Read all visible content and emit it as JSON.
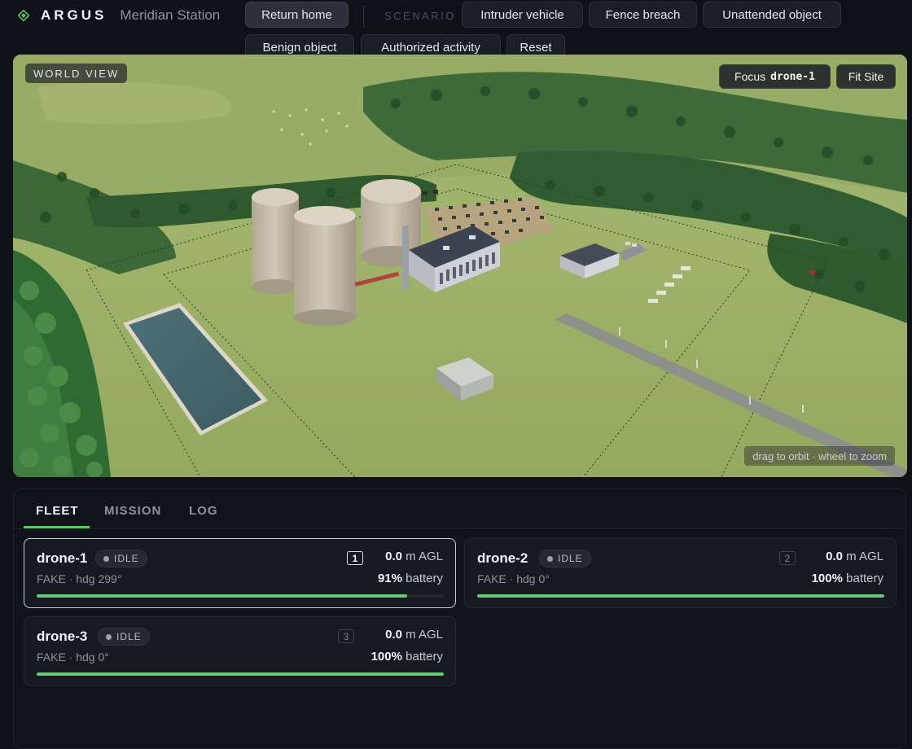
{
  "header": {
    "brand": "ARGUS",
    "station": "Meridian Station",
    "return_home": "Return home",
    "scenario_label": "SCENARIO",
    "scenarios": [
      "Intruder vehicle",
      "Fence breach",
      "Unattended object",
      "Benign object",
      "Authorized activity",
      "Reset"
    ]
  },
  "world": {
    "title": "WORLD VIEW",
    "focus_label": "Focus",
    "focus_target": "drone-1",
    "fit_site": "Fit Site",
    "hint": "drag to orbit · wheel to zoom"
  },
  "tabs": [
    "FLEET",
    "MISSION",
    "LOG"
  ],
  "active_tab": "FLEET",
  "drones": [
    {
      "name": "drone-1",
      "status": "IDLE",
      "index": "1",
      "altitude": "0.0",
      "altitude_unit": "m AGL",
      "mode": "FAKE · hdg 299°",
      "battery": "91%",
      "battery_label": "battery",
      "battery_fraction": 0.91,
      "selected": true
    },
    {
      "name": "drone-2",
      "status": "IDLE",
      "index": "2",
      "altitude": "0.0",
      "altitude_unit": "m AGL",
      "mode": "FAKE · hdg 0°",
      "battery": "100%",
      "battery_label": "battery",
      "battery_fraction": 1.0,
      "selected": false
    },
    {
      "name": "drone-3",
      "status": "IDLE",
      "index": "3",
      "altitude": "0.0",
      "altitude_unit": "m AGL",
      "mode": "FAKE · hdg 0°",
      "battery": "100%",
      "battery_label": "battery",
      "battery_fraction": 1.0,
      "selected": false
    }
  ],
  "colors": {
    "accent": "#6bc877",
    "background": "#0e1116",
    "brand_icon": "#5cc46a"
  }
}
